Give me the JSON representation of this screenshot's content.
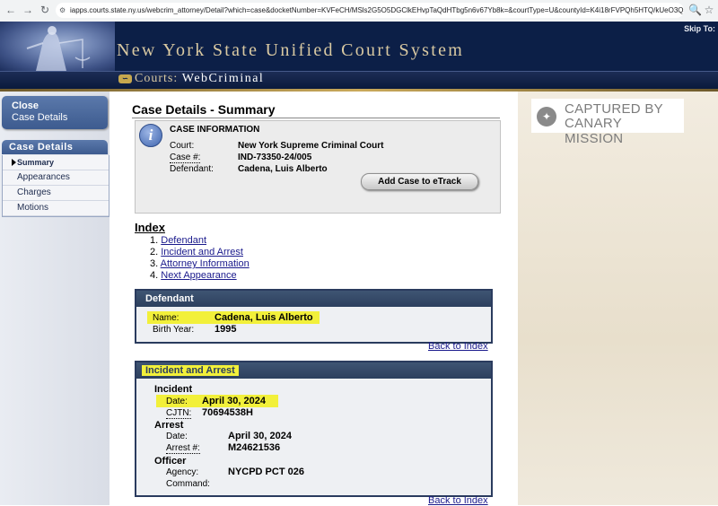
{
  "browser": {
    "url_host": "iapps.courts.state.ny.us",
    "url_path": "/webcrim_attorney/Detail?which=case&docketNumber=KVFeCH/MSls2G5O5DGClkEHvpTaQdHTbg5n6v67Yb8k=&courtType=U&countyId=K4i18rFVPQh5HTQ/kUeO3Q==&docketId=MNLXu..."
  },
  "header": {
    "title": "New York State Unified Court System",
    "courts_label": "Courts:",
    "app_name": "WebCriminal",
    "skip_link": "Skip To:"
  },
  "sidebar": {
    "close_line1": "Close",
    "close_line2": "Case Details",
    "section_title": "Case Details",
    "items": [
      {
        "label": "Summary",
        "active": true
      },
      {
        "label": "Appearances"
      },
      {
        "label": "Charges"
      },
      {
        "label": "Motions"
      }
    ]
  },
  "watermark": {
    "line1": "CAPTURED BY",
    "line2": "CANARY MISSION"
  },
  "main": {
    "page_title": "Case Details - Summary",
    "case_info": {
      "heading": "CASE INFORMATION",
      "court_label": "Court:",
      "court_value": "New York Supreme Criminal Court",
      "case_label": "Case #:",
      "case_value": "IND-73350-24/005",
      "defendant_label": "Defendant:",
      "defendant_value": "Cadena, Luis Alberto",
      "etrack_button": "Add Case to eTrack"
    },
    "index": {
      "title": "Index",
      "items": [
        {
          "num": "1.",
          "label": "Defendant"
        },
        {
          "num": "2.",
          "label": "Incident and Arrest"
        },
        {
          "num": "3.",
          "label": "Attorney Information"
        },
        {
          "num": "4.",
          "label": "Next Appearance"
        }
      ]
    },
    "defendant": {
      "title": "Defendant",
      "name_label": "Name:",
      "name_value": "Cadena, Luis Alberto",
      "birth_label": "Birth Year:",
      "birth_value": "1995"
    },
    "back_to_index": "Back to Index",
    "incident": {
      "title": "Incident and Arrest",
      "incident_heading": "Incident",
      "date_label": "Date:",
      "date_value": "April 30, 2024",
      "cjtn_label": "CJTN:",
      "cjtn_value": "70694538H",
      "arrest_heading": "Arrest",
      "arrest_date_label": "Date:",
      "arrest_date_value": "April 30, 2024",
      "arrest_num_label": "Arrest #:",
      "arrest_num_value": "M24621536",
      "officer_heading": "Officer",
      "agency_label": "Agency:",
      "agency_value": "NYCPD PCT 026",
      "command_label": "Command:",
      "command_value": ""
    }
  },
  "colors": {
    "header_bg": "#0c1f47",
    "title_gold": "#d9c9a2",
    "section_bar": "#2c3f5e",
    "highlight": "#f2f03a",
    "link": "#1a1a8c"
  }
}
